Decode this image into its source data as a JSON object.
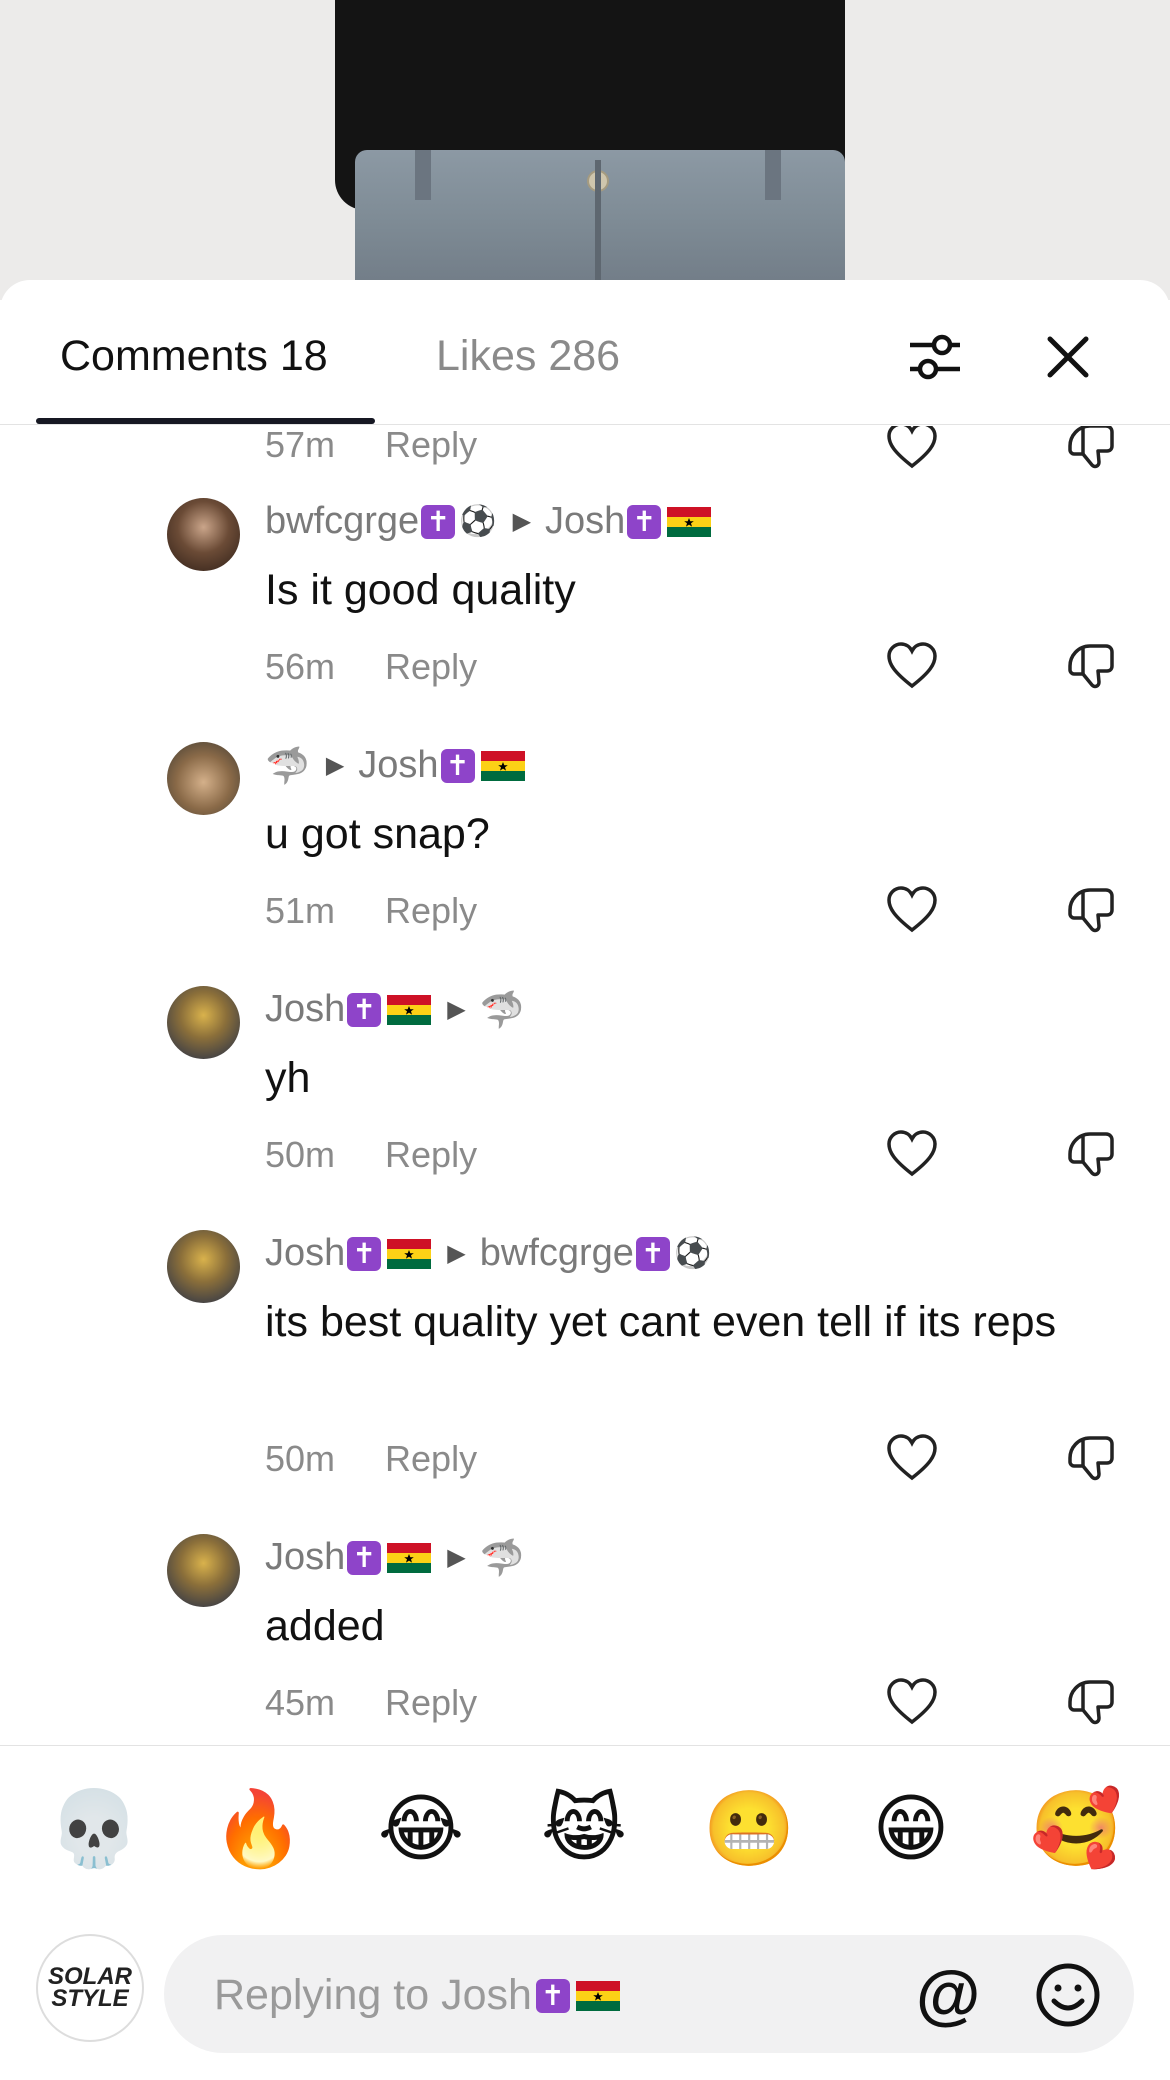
{
  "header": {
    "comments_label": "Comments 18",
    "likes_label": "Likes 286"
  },
  "comments": [
    {
      "time": "57m",
      "reply": "Reply"
    },
    {
      "author": "bwfcgrge",
      "reply_to": "Josh",
      "text": "Is it good quality",
      "time": "56m",
      "reply": "Reply"
    },
    {
      "author": "🦈",
      "reply_to": "Josh",
      "text": "u got snap?",
      "time": "51m",
      "reply": "Reply"
    },
    {
      "author": "Josh",
      "reply_to": "🦈",
      "text": "yh",
      "time": "50m",
      "reply": "Reply"
    },
    {
      "author": "Josh",
      "reply_to": "bwfcgrge",
      "text": "its best quality yet cant even tell if its reps",
      "time": "50m",
      "reply": "Reply"
    },
    {
      "author": "Josh",
      "reply_to": "🦈",
      "text": "added",
      "time": "45m",
      "reply": "Reply"
    }
  ],
  "emoji_bar": [
    "💀",
    "🔥",
    "😂",
    "😹",
    "😬",
    "😁",
    "🥰"
  ],
  "composer": {
    "placeholder": "Replying to Josh",
    "avatar_text": "SOLAR STYLE",
    "at_symbol": "@"
  },
  "colors": {
    "badge": "#8e44c9",
    "tab_underline": "#161823",
    "muted_text": "#8a8a8a"
  }
}
